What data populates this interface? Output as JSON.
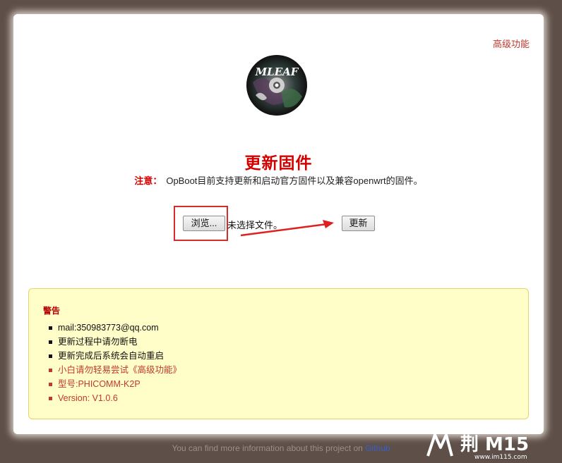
{
  "header": {
    "advanced_link": "高级功能"
  },
  "logo": {
    "text": "MLEAF"
  },
  "main": {
    "title": "更新固件",
    "note_label": "注意：",
    "note_text": "OpBoot目前支持更新和启动官方固件以及兼容openwrt的固件。",
    "browse_label": "浏览...",
    "file_status": "未选择文件。",
    "update_label": "更新"
  },
  "warning": {
    "title": "警告",
    "items": [
      {
        "text": "mail:350983773@qq.com",
        "color": "black"
      },
      {
        "text": "更新过程中请勿断电",
        "color": "black"
      },
      {
        "text": "更新完成后系统会自动重启",
        "color": "black"
      },
      {
        "text": "小白请勿轻易尝试《高级功能》",
        "color": "red"
      },
      {
        "text": "型号:PHICOMM-K2P",
        "color": "red"
      },
      {
        "text": "Version: V1.0.6",
        "color": "red"
      }
    ]
  },
  "footer": {
    "text": "You can find more information about this project on ",
    "link": "Github"
  },
  "watermark": {
    "brand": "荆 M15",
    "url": "www.im115.com"
  },
  "colors": {
    "accent": "#d40000",
    "background": "#5e4f48",
    "warning_bg": "#fffdc8"
  }
}
